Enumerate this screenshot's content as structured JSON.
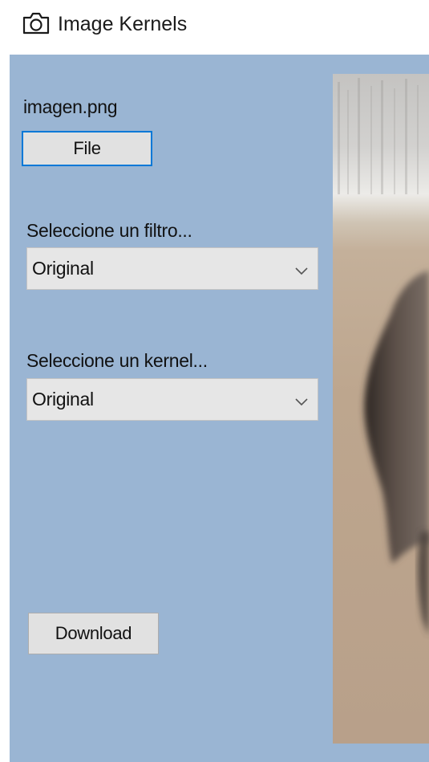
{
  "window": {
    "title": "Image Kernels",
    "title_icon": "camera-icon"
  },
  "file_section": {
    "filename": "imagen.png",
    "file_button_label": "File"
  },
  "filter_section": {
    "label": "Seleccione un filtro...",
    "selected": "Original"
  },
  "kernel_section": {
    "label": "Seleccione un kernel...",
    "selected": "Original"
  },
  "download_button_label": "Download",
  "colors": {
    "panel_background": "#9ab5d3",
    "button_face": "#e1e1e1",
    "focus_border": "#0078d7"
  }
}
